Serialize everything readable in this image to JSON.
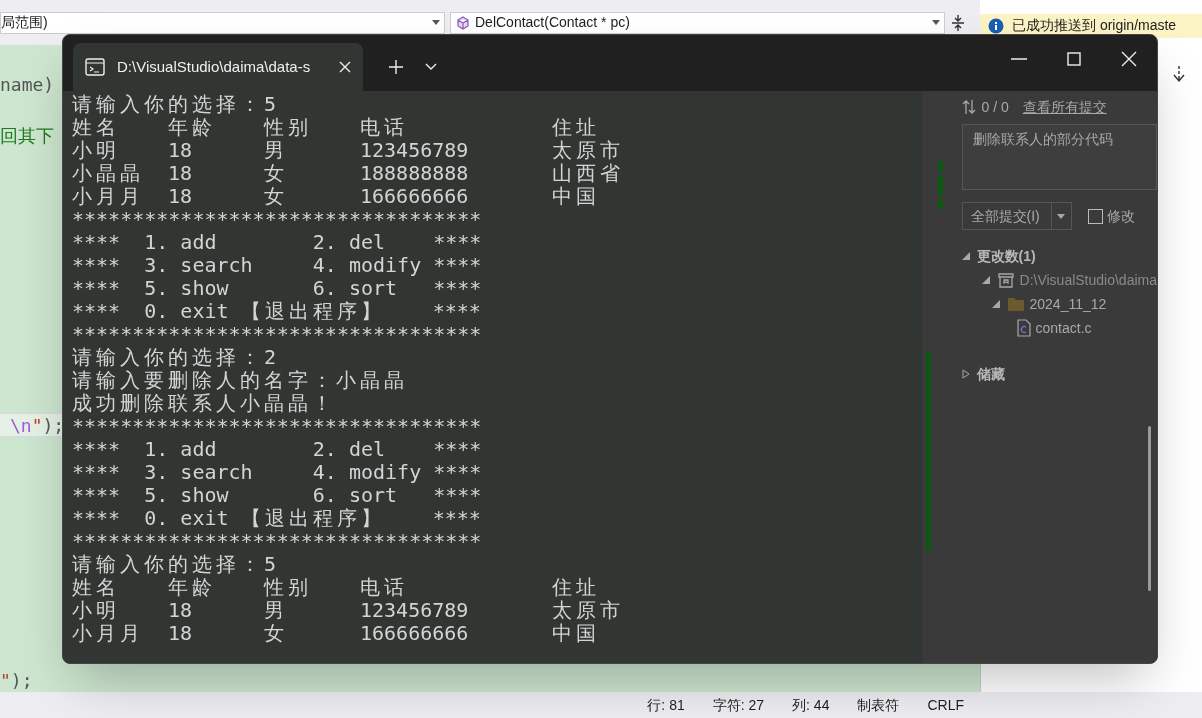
{
  "editor": {
    "scope_dropdown": "局范围)",
    "function_dropdown": "DelContact(Contact * pc)",
    "code_lines": [
      {
        "tokens": [
          {
            "kind": "plain",
            "text": "name)"
          }
        ],
        "current": false
      },
      {
        "tokens": [
          {
            "kind": "comment",
            "text": "回其下"
          }
        ],
        "current": false
      },
      {
        "tokens": [
          {
            "kind": "escape",
            "text": "\\n"
          },
          {
            "kind": "string",
            "text": "\""
          },
          {
            "kind": "plain",
            "text": ");"
          }
        ],
        "current": true
      },
      {
        "tokens": [
          {
            "kind": "string",
            "text": "\""
          },
          {
            "kind": "plain",
            "text": ");"
          }
        ],
        "current": false
      }
    ]
  },
  "notice": "已成功推送到 origin/maste",
  "terminal": {
    "tab_title": "D:\\VisualStudio\\daima\\data-s",
    "lines": [
      {
        "kind": "text",
        "text": "请输入你的选择：5"
      },
      {
        "kind": "row",
        "cells": [
          "姓名",
          "年龄",
          "性别",
          "电话",
          "住址"
        ]
      },
      {
        "kind": "row",
        "cells": [
          "小明",
          "18",
          "男",
          "123456789",
          "太原市"
        ]
      },
      {
        "kind": "row",
        "cells": [
          "小晶晶",
          "18",
          "女",
          "188888888",
          "山西省"
        ]
      },
      {
        "kind": "row",
        "cells": [
          "小月月",
          "18",
          "女",
          "166666666",
          "中国"
        ]
      },
      {
        "kind": "text",
        "text": "**********************************"
      },
      {
        "kind": "text",
        "text": "****  1. add        2. del    ****"
      },
      {
        "kind": "text",
        "text": "****  3. search     4. modify ****"
      },
      {
        "kind": "text",
        "text": "****  5. show       6. sort   ****"
      },
      {
        "kind": "text",
        "text": "****  0. exit 【退出程序】    ****"
      },
      {
        "kind": "text",
        "text": "**********************************"
      },
      {
        "kind": "text",
        "text": "请输入你的选择：2"
      },
      {
        "kind": "text",
        "text": "请输入要删除人的名字：小晶晶"
      },
      {
        "kind": "text",
        "text": "成功删除联系人小晶晶！"
      },
      {
        "kind": "text",
        "text": "**********************************"
      },
      {
        "kind": "text",
        "text": "****  1. add        2. del    ****"
      },
      {
        "kind": "text",
        "text": "****  3. search     4. modify ****"
      },
      {
        "kind": "text",
        "text": "****  5. show       6. sort   ****"
      },
      {
        "kind": "text",
        "text": "****  0. exit 【退出程序】    ****"
      },
      {
        "kind": "text",
        "text": "**********************************"
      },
      {
        "kind": "text",
        "text": "请输入你的选择：5"
      },
      {
        "kind": "row",
        "cells": [
          "姓名",
          "年龄",
          "性别",
          "电话",
          "住址"
        ]
      },
      {
        "kind": "row",
        "cells": [
          "小明",
          "18",
          "男",
          "123456789",
          "太原市"
        ]
      },
      {
        "kind": "row",
        "cells": [
          "小月月",
          "18",
          "女",
          "166666666",
          "中国"
        ]
      }
    ]
  },
  "git_panel": {
    "commit_counts": "0 / 0",
    "view_all_link": "查看所有提交",
    "message": "删除联系人的部分代码",
    "commit_button": "全部提交(I)",
    "amend": {
      "label": "修改",
      "checked": false
    },
    "tree": [
      {
        "label": "更改数(1)",
        "kind": "section",
        "expanded": true,
        "children": [
          {
            "label": "D:\\VisualStudio\\daima",
            "kind": "repo",
            "expanded": true,
            "children": [
              {
                "label": "2024_11_12",
                "kind": "folder",
                "expanded": true,
                "children": [
                  {
                    "label": "contact.c",
                    "kind": "file"
                  }
                ]
              }
            ]
          }
        ]
      },
      {
        "label": "储藏",
        "kind": "section",
        "expanded": false
      }
    ]
  },
  "status_bar": [
    "行: 81",
    "字符: 27",
    "列: 44",
    "制表符",
    "CRLF"
  ]
}
